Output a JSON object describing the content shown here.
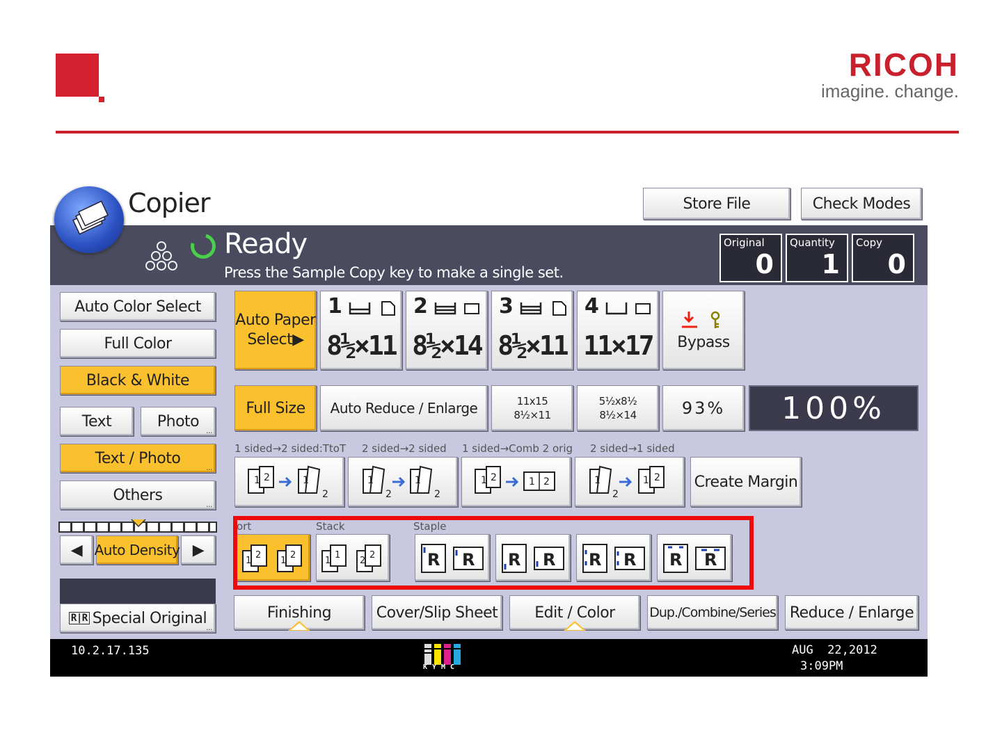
{
  "brand": {
    "name": "RICOH",
    "tagline": "imagine. change."
  },
  "app": {
    "title": "Copier"
  },
  "header_buttons": {
    "store_file": "Store File",
    "check_modes": "Check Modes"
  },
  "status": {
    "title": "Ready",
    "message": "Press the Sample Copy key to make a single set."
  },
  "counters": [
    {
      "label": "Original",
      "value": "0"
    },
    {
      "label": "Quantity",
      "value": "1"
    },
    {
      "label": "Copy",
      "value": "0"
    }
  ],
  "color_mode": {
    "auto_color": "Auto Color Select",
    "full_color": "Full Color",
    "black_white": "Black & White"
  },
  "original_type": {
    "text": "Text",
    "photo": "Photo",
    "text_photo": "Text / Photo",
    "others": "Others"
  },
  "density": {
    "label": "Auto Density"
  },
  "special_original": {
    "label": "Special Original"
  },
  "paper": {
    "auto_line1": "Auto Paper",
    "auto_line2": "Select▶",
    "trays": [
      {
        "num": "1",
        "size": "8½×11"
      },
      {
        "num": "2",
        "size": "8½×14"
      },
      {
        "num": "3",
        "size": "8½×11"
      },
      {
        "num": "4",
        "size": "11×17"
      }
    ],
    "bypass": "Bypass"
  },
  "reduce_enlarge": {
    "full_size": "Full Size",
    "auto": "Auto Reduce / Enlarge",
    "preset1_top": "11x15",
    "preset1_bottom": "8½×11",
    "preset2_top": "5½x8½",
    "preset2_bottom": "8½×14",
    "preset3": "93%",
    "current": "100%"
  },
  "duplex": {
    "labels": [
      "1 sided→2 sided:TtoT",
      "2 sided→2 sided",
      "1 sided→Comb 2 orig",
      "2 sided→1 sided"
    ],
    "create_margin": "Create Margin"
  },
  "finishing_row": {
    "sort": "ort",
    "stack": "Stack",
    "staple": "Staple"
  },
  "tabs": [
    {
      "label": "Finishing"
    },
    {
      "label": "Cover/Slip Sheet"
    },
    {
      "label": "Edit / Color"
    },
    {
      "label": "Dup./Combine/Series"
    },
    {
      "label": "Reduce / Enlarge"
    }
  ],
  "footer": {
    "ip": "10.2.17.135",
    "date": "AUG  22,2012",
    "time": "3:09PM",
    "toner_letters": "KYMC"
  },
  "colors": {
    "accent": "#c8202c",
    "selected": "#fbc02d",
    "panel": "#c8c8e0",
    "status": "#4b4b5f",
    "highlight": "#ee0a0a"
  }
}
